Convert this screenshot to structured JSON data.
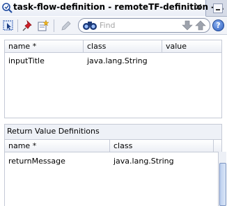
{
  "window": {
    "title": "task-flow-definition - remoteTF-definition -...",
    "close_label": "✕"
  },
  "toolbar": {
    "search_placeholder": "Find",
    "help_label": "?"
  },
  "input_params": {
    "columns": [
      "name *",
      "class",
      "value"
    ],
    "rows": [
      {
        "name": "inputTitle",
        "class": "java.lang.String",
        "value": ""
      }
    ]
  },
  "return_values": {
    "section_label": "Return Value Definitions",
    "columns": [
      "name *",
      "class"
    ],
    "rows": [
      {
        "name": "returnMessage",
        "class": "java.lang.String"
      }
    ]
  },
  "colors": {
    "accent": "#2c5fbf",
    "tab_background": "#d6dbe7"
  }
}
